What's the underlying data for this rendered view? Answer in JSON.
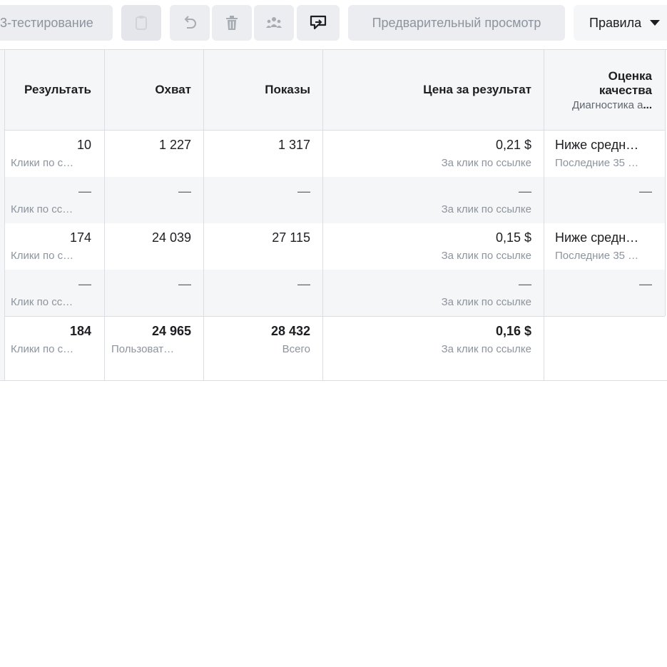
{
  "toolbar": {
    "ab_test_label": "3-тестирование",
    "preview_label": "Предварительный просмотр",
    "rules_label": "Правила",
    "icons": [
      "clipboard-icon",
      "undo-icon",
      "trash-icon",
      "people-icon",
      "share-icon"
    ]
  },
  "table": {
    "headers": {
      "result": "Результать",
      "reach": "Охват",
      "impressions": "Показы",
      "cost_per_result": "Цена за результат",
      "quality_line1": "Оценка",
      "quality_line2": "качества",
      "quality_sub_prefix": "Диагностика а",
      "quality_sub_bold": "..."
    },
    "rows": [
      {
        "result": "10",
        "result_sub": "Клики по с…",
        "reach": "1 227",
        "impressions": "1 317",
        "cost": "0,21 $",
        "cost_sub": "За клик по ссылке",
        "quality": "Ниже средн…",
        "quality_sub": "Последние 35 …"
      },
      {
        "result": "—",
        "result_sub": "Клик по сс…",
        "reach": "—",
        "impressions": "—",
        "cost": "—",
        "cost_sub": "За клик по ссылке",
        "quality": "—",
        "quality_sub": ""
      },
      {
        "result": "174",
        "result_sub": "Клики по с…",
        "reach": "24 039",
        "impressions": "27 115",
        "cost": "0,15 $",
        "cost_sub": "За клик по ссылке",
        "quality": "Ниже средн…",
        "quality_sub": "Последние 35 …"
      },
      {
        "result": "—",
        "result_sub": "Клик по сс…",
        "reach": "—",
        "impressions": "—",
        "cost": "—",
        "cost_sub": "За клик по ссылке",
        "quality": "—",
        "quality_sub": ""
      }
    ],
    "total": {
      "result": "184",
      "result_sub": "Клики по с…",
      "reach": "24 965",
      "reach_sub": "Пользоват…",
      "impressions": "28 432",
      "impressions_sub": "Всего",
      "cost": "0,16 $",
      "cost_sub": "За клик по ссылке"
    }
  },
  "colors": {
    "button_bg": "#ebedf0",
    "header_bg": "#f5f6f7",
    "border": "#dadde1",
    "muted_text": "#8d949e",
    "text": "#1c1e21"
  }
}
